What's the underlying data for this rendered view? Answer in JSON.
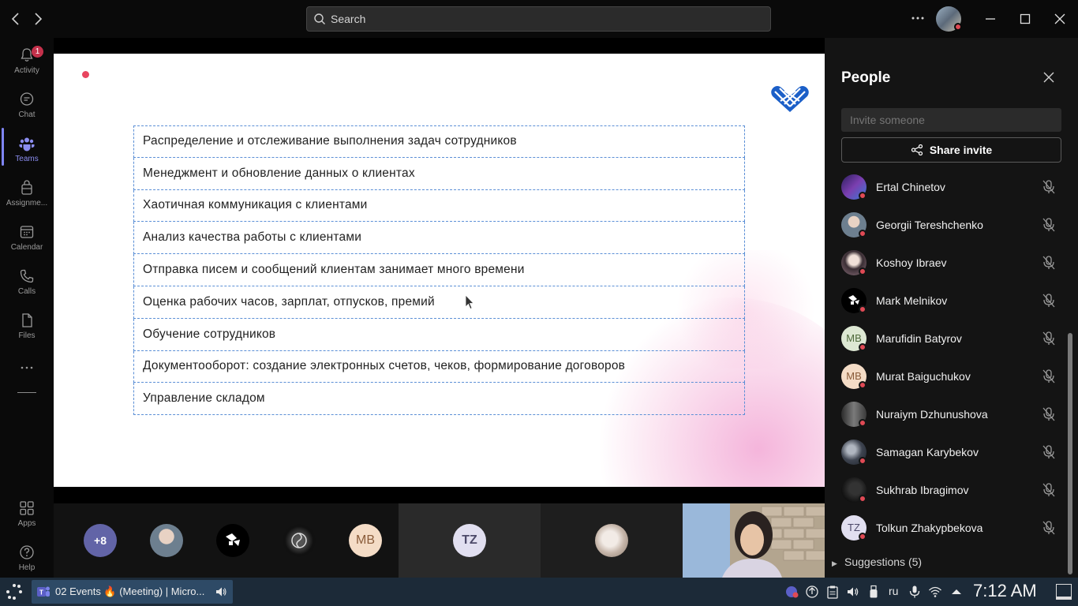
{
  "titlebar": {
    "search_placeholder": "Search",
    "back_icon": "chevron-left-icon",
    "forward_icon": "chevron-right-icon",
    "more_icon": "ellipsis-icon"
  },
  "rail": {
    "items": [
      {
        "label": "Activity",
        "icon": "bell-icon",
        "badge": "1"
      },
      {
        "label": "Chat",
        "icon": "chat-icon"
      },
      {
        "label": "Teams",
        "icon": "teams-icon"
      },
      {
        "label": "Assignme...",
        "icon": "assignments-icon"
      },
      {
        "label": "Calendar",
        "icon": "calendar-icon"
      },
      {
        "label": "Calls",
        "icon": "phone-icon"
      },
      {
        "label": "Files",
        "icon": "file-icon"
      },
      {
        "label": "Apps",
        "icon": "apps-icon"
      },
      {
        "label": "Help",
        "icon": "help-icon"
      }
    ],
    "active": "Teams",
    "more_label": "..."
  },
  "slide": {
    "rows": [
      "Распределение и отслеживание выполнения задач сотрудников",
      "Менеджмент и обновление данных о клиентах",
      "Хаотичная коммуникация с клиентами",
      "Анализ качества работы с клиентами",
      "Отправка писем и сообщений клиентам занимает много времени",
      "Оценка рабочих часов, зарплат, отпусков, премий",
      "Обучение сотрудников",
      "Документооборот: создание электронных счетов, чеков, формирование договоров",
      "Управление складом"
    ]
  },
  "strip": {
    "more_count": "+8",
    "initials_mb": "MB",
    "initials_tz": "TZ"
  },
  "people": {
    "title": "People",
    "invite_placeholder": "Invite someone",
    "share_label": "Share invite",
    "participants": [
      {
        "name": "Ertal Chinetov",
        "initials": ""
      },
      {
        "name": "Georgii Tereshchenko",
        "initials": ""
      },
      {
        "name": "Koshoy Ibraev",
        "initials": ""
      },
      {
        "name": "Mark Melnikov",
        "initials": ""
      },
      {
        "name": "Marufidin Batyrov",
        "initials": "MB"
      },
      {
        "name": "Murat Baiguchukov",
        "initials": "MB"
      },
      {
        "name": "Nuraiym Dzhunushova",
        "initials": ""
      },
      {
        "name": "Samagan Karybekov",
        "initials": ""
      },
      {
        "name": "Sukhrab Ibragimov",
        "initials": ""
      },
      {
        "name": "Tolkun Zhakypbekova",
        "initials": "TZ"
      }
    ],
    "suggestions_label": "Suggestions (5)"
  },
  "taskbar": {
    "app_label": "02 Events 🔥 (Meeting) | Micro...",
    "language": "ru",
    "clock": "7:12 AM"
  },
  "colors": {
    "accent": "#7f85f5",
    "presence_busy": "#e04a55",
    "slide_border": "#5b8fd6",
    "slide_logo": "#1b5fc8"
  }
}
